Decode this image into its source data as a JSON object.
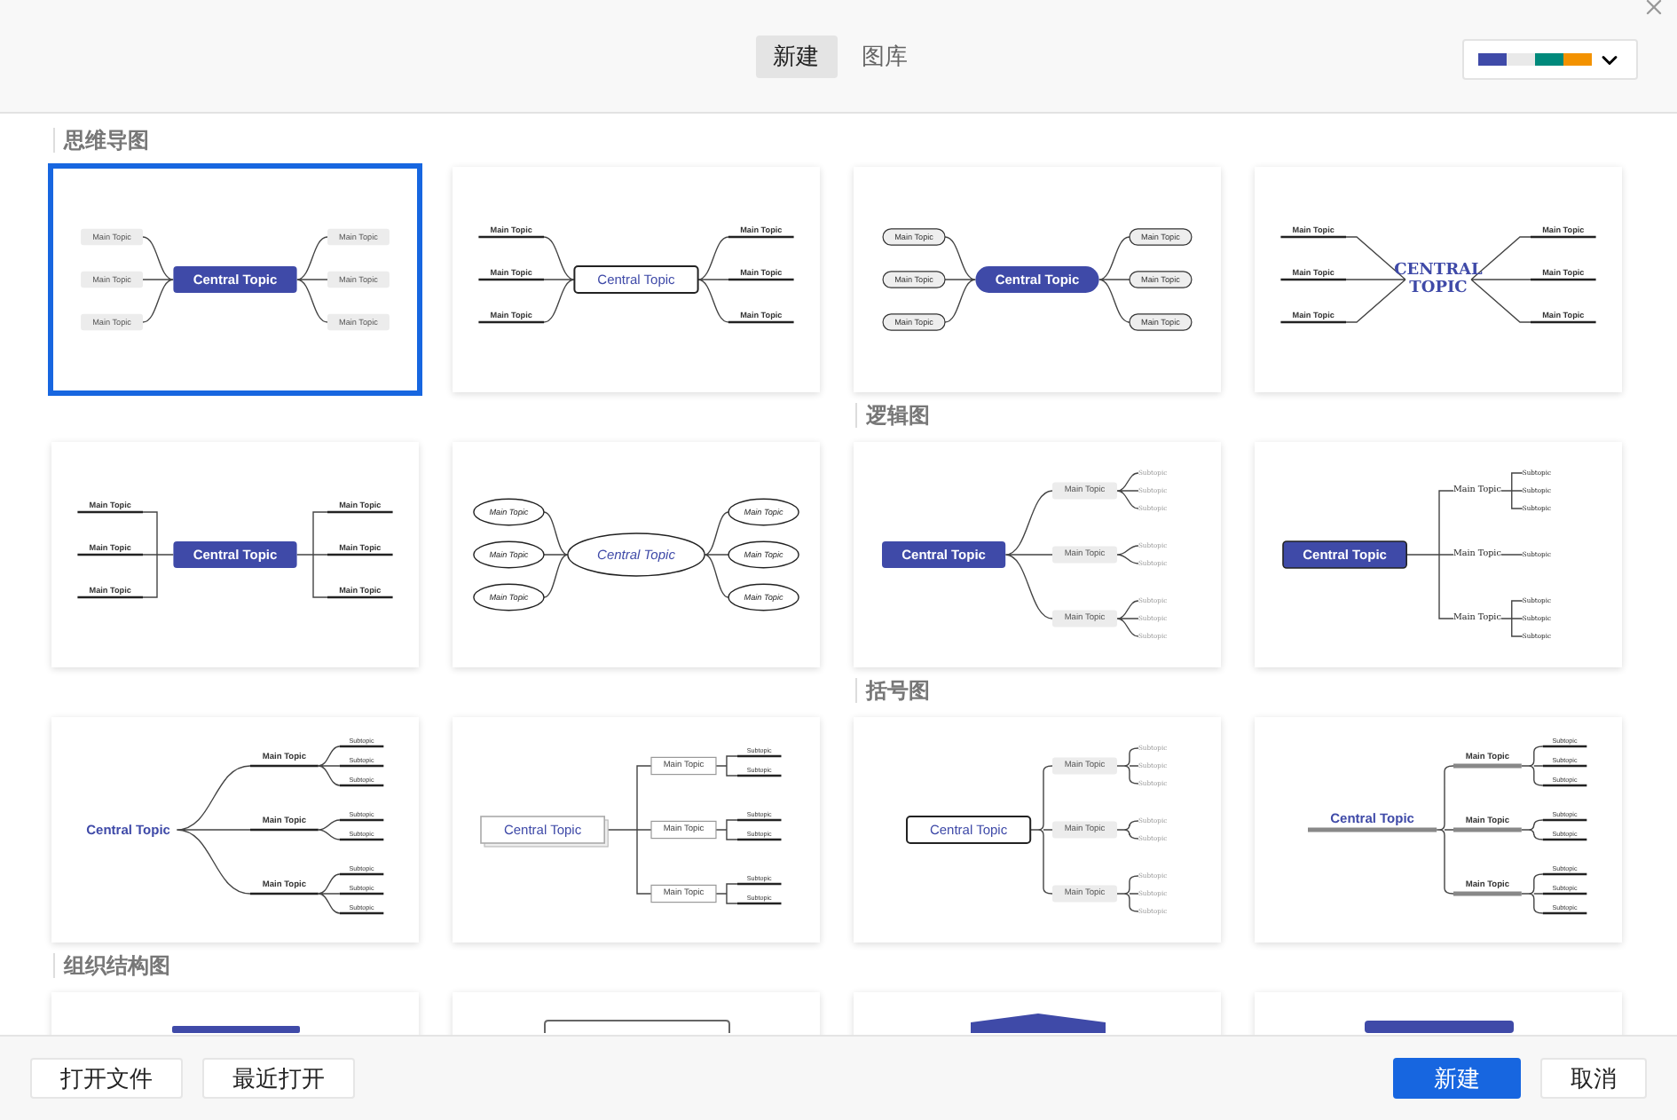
{
  "header": {
    "tabs": [
      {
        "label": "新建",
        "selected": true
      },
      {
        "label": "图库",
        "selected": false
      }
    ],
    "theme_swatches": [
      {
        "color": "#3f4aa8"
      },
      {
        "color": "#e9e9e9"
      },
      {
        "color": "#00897b"
      },
      {
        "color": "#f39200"
      }
    ]
  },
  "sections": [
    {
      "title": "思维导图",
      "templates": [
        {
          "kind": "two-sided",
          "selected": true,
          "links": {
            "kind": "curve"
          },
          "central": {
            "kind": "filled",
            "text": "Central Topic"
          },
          "left": [
            {
              "kind": "box",
              "text": "Main Topic"
            },
            {
              "kind": "box",
              "text": "Main Topic"
            },
            {
              "kind": "box",
              "text": "Main Topic"
            }
          ],
          "right": [
            {
              "kind": "box",
              "text": "Main Topic"
            },
            {
              "kind": "box",
              "text": "Main Topic"
            },
            {
              "kind": "box",
              "text": "Main Topic"
            }
          ]
        },
        {
          "kind": "two-sided",
          "selected": false,
          "links": {
            "kind": "curve"
          },
          "central": {
            "kind": "outline",
            "text": "Central Topic"
          },
          "left": [
            {
              "kind": "underline",
              "text": "Main Topic"
            },
            {
              "kind": "underline",
              "text": "Main Topic"
            },
            {
              "kind": "underline",
              "text": "Main Topic"
            }
          ],
          "right": [
            {
              "kind": "underline",
              "text": "Main Topic"
            },
            {
              "kind": "underline",
              "text": "Main Topic"
            },
            {
              "kind": "underline",
              "text": "Main Topic"
            }
          ]
        },
        {
          "kind": "two-sided",
          "selected": false,
          "links": {
            "kind": "curve"
          },
          "central": {
            "kind": "pill",
            "text": "Central Topic"
          },
          "left": [
            {
              "kind": "outlined",
              "text": "Main Topic"
            },
            {
              "kind": "outlined",
              "text": "Main Topic"
            },
            {
              "kind": "outlined",
              "text": "Main Topic"
            }
          ],
          "right": [
            {
              "kind": "outlined",
              "text": "Main Topic"
            },
            {
              "kind": "outlined",
              "text": "Main Topic"
            },
            {
              "kind": "outlined",
              "text": "Main Topic"
            }
          ]
        },
        {
          "kind": "two-sided",
          "selected": false,
          "links": {
            "kind": "slant"
          },
          "central": {
            "kind": "serif",
            "text": "CENTRAL TOPIC"
          },
          "left": [
            {
              "kind": "underline",
              "text": "Main Topic"
            },
            {
              "kind": "underline",
              "text": "Main Topic"
            },
            {
              "kind": "underline",
              "text": "Main Topic"
            }
          ],
          "right": [
            {
              "kind": "underline",
              "text": "Main Topic"
            },
            {
              "kind": "underline",
              "text": "Main Topic"
            },
            {
              "kind": "underline",
              "text": "Main Topic"
            }
          ]
        },
        {
          "kind": "two-sided",
          "selected": false,
          "links": {
            "kind": "elbow"
          },
          "central": {
            "kind": "filled",
            "text": "Central Topic"
          },
          "left": [
            {
              "kind": "underline",
              "text": "Main Topic"
            },
            {
              "kind": "underline",
              "text": "Main Topic"
            },
            {
              "kind": "underline",
              "text": "Main Topic"
            }
          ],
          "right": [
            {
              "kind": "underline",
              "text": "Main Topic"
            },
            {
              "kind": "underline",
              "text": "Main Topic"
            },
            {
              "kind": "underline",
              "text": "Main Topic"
            }
          ]
        },
        {
          "kind": "two-sided",
          "selected": false,
          "links": {
            "kind": "curve"
          },
          "central": {
            "kind": "ellipse",
            "text": "Central Topic"
          },
          "left": [
            {
              "kind": "ellipse",
              "text": "Main Topic"
            },
            {
              "kind": "ellipse",
              "text": "Main Topic"
            },
            {
              "kind": "ellipse",
              "text": "Main Topic"
            }
          ],
          "right": [
            {
              "kind": "ellipse",
              "text": "Main Topic"
            },
            {
              "kind": "ellipse",
              "text": "Main Topic"
            },
            {
              "kind": "ellipse",
              "text": "Main Topic"
            }
          ]
        }
      ]
    },
    {
      "title": "逻辑图",
      "templates": [
        {
          "kind": "tree",
          "selected": false,
          "links": {
            "kind": "curve"
          },
          "central": {
            "kind": "filled",
            "text": "Central Topic"
          },
          "topics": [
            {
              "kind": "box",
              "text": "Main Topic",
              "links": {
                "kind": "curve"
              },
              "subtopics": [
                {
                  "kind": "faint",
                  "text": "Subtopic"
                },
                {
                  "kind": "faint",
                  "text": "Subtopic"
                },
                {
                  "kind": "faint",
                  "text": "Subtopic"
                }
              ]
            },
            {
              "kind": "box",
              "text": "Main Topic",
              "links": {
                "kind": "curve"
              },
              "subtopics": [
                {
                  "kind": "faint",
                  "text": "Subtopic"
                },
                {
                  "kind": "faint",
                  "text": "Subtopic"
                }
              ]
            },
            {
              "kind": "box",
              "text": "Main Topic",
              "links": {
                "kind": "curve"
              },
              "subtopics": [
                {
                  "kind": "faint",
                  "text": "Subtopic"
                },
                {
                  "kind": "faint",
                  "text": "Subtopic"
                },
                {
                  "kind": "faint",
                  "text": "Subtopic"
                }
              ]
            }
          ]
        },
        {
          "kind": "tree",
          "selected": false,
          "links": {
            "kind": "elbow"
          },
          "central": {
            "kind": "framed",
            "text": "Central Topic"
          },
          "topics": [
            {
              "kind": "serif",
              "text": "Main Topic",
              "links": {
                "kind": "elbow"
              },
              "subtopics": [
                {
                  "kind": "serif",
                  "text": "Subtopic"
                },
                {
                  "kind": "serif",
                  "text": "Subtopic"
                },
                {
                  "kind": "serif",
                  "text": "Subtopic"
                }
              ]
            },
            {
              "kind": "serif",
              "text": "Main Topic",
              "links": {
                "kind": "elbow"
              },
              "subtopics": [
                {
                  "kind": "serif",
                  "text": "Subtopic"
                }
              ]
            },
            {
              "kind": "serif",
              "text": "Main Topic",
              "links": {
                "kind": "elbow"
              },
              "subtopics": [
                {
                  "kind": "serif",
                  "text": "Subtopic"
                },
                {
                  "kind": "serif",
                  "text": "Subtopic"
                },
                {
                  "kind": "serif",
                  "text": "Subtopic"
                }
              ]
            }
          ]
        },
        {
          "kind": "tree",
          "selected": false,
          "links": {
            "kind": "curve"
          },
          "central": {
            "kind": "text",
            "text": "Central Topic"
          },
          "topics": [
            {
              "kind": "underline",
              "text": "Main Topic",
              "links": {
                "kind": "curve"
              },
              "subtopics": [
                {
                  "kind": "underline",
                  "text": "Subtopic"
                },
                {
                  "kind": "underline",
                  "text": "Subtopic"
                },
                {
                  "kind": "underline",
                  "text": "Subtopic"
                }
              ]
            },
            {
              "kind": "underline",
              "text": "Main Topic",
              "links": {
                "kind": "curve"
              },
              "subtopics": [
                {
                  "kind": "underline",
                  "text": "Subtopic"
                },
                {
                  "kind": "underline",
                  "text": "Subtopic"
                }
              ]
            },
            {
              "kind": "underline",
              "text": "Main Topic",
              "links": {
                "kind": "curve"
              },
              "subtopics": [
                {
                  "kind": "underline",
                  "text": "Subtopic"
                },
                {
                  "kind": "underline",
                  "text": "Subtopic"
                },
                {
                  "kind": "underline",
                  "text": "Subtopic"
                }
              ]
            }
          ]
        },
        {
          "kind": "tree",
          "selected": false,
          "links": {
            "kind": "elbow"
          },
          "central": {
            "kind": "stacked",
            "text": "Central Topic"
          },
          "topics": [
            {
              "kind": "card",
              "text": "Main Topic",
              "links": {
                "kind": "elbow"
              },
              "subtopics": [
                {
                  "kind": "underline",
                  "text": "Subtopic"
                },
                {
                  "kind": "underline",
                  "text": "Subtopic"
                }
              ]
            },
            {
              "kind": "card",
              "text": "Main Topic",
              "links": {
                "kind": "elbow"
              },
              "subtopics": [
                {
                  "kind": "underline",
                  "text": "Subtopic"
                },
                {
                  "kind": "underline",
                  "text": "Subtopic"
                }
              ]
            },
            {
              "kind": "card",
              "text": "Main Topic",
              "links": {
                "kind": "elbow"
              },
              "subtopics": [
                {
                  "kind": "underline",
                  "text": "Subtopic"
                },
                {
                  "kind": "underline",
                  "text": "Subtopic"
                }
              ]
            }
          ]
        }
      ]
    },
    {
      "title": "括号图",
      "templates": [
        {
          "kind": "tree",
          "selected": false,
          "links": {
            "kind": "brace"
          },
          "central": {
            "kind": "outline",
            "text": "Central Topic"
          },
          "topics": [
            {
              "kind": "box",
              "text": "Main Topic",
              "links": {
                "kind": "brace"
              },
              "subtopics": [
                {
                  "kind": "faint",
                  "text": "Subtopic"
                },
                {
                  "kind": "faint",
                  "text": "Subtopic"
                },
                {
                  "kind": "faint",
                  "text": "Subtopic"
                }
              ]
            },
            {
              "kind": "box",
              "text": "Main Topic",
              "links": {
                "kind": "brace"
              },
              "subtopics": [
                {
                  "kind": "faint",
                  "text": "Subtopic"
                },
                {
                  "kind": "faint",
                  "text": "Subtopic"
                }
              ]
            },
            {
              "kind": "box",
              "text": "Main Topic",
              "links": {
                "kind": "brace"
              },
              "subtopics": [
                {
                  "kind": "faint",
                  "text": "Subtopic"
                },
                {
                  "kind": "faint",
                  "text": "Subtopic"
                },
                {
                  "kind": "faint",
                  "text": "Subtopic"
                }
              ]
            }
          ]
        },
        {
          "kind": "tree",
          "selected": false,
          "links": {
            "kind": "brace"
          },
          "central": {
            "kind": "bar",
            "text": "Central Topic"
          },
          "topics": [
            {
              "kind": "bar",
              "text": "Main Topic",
              "links": {
                "kind": "brace"
              },
              "subtopics": [
                {
                  "kind": "underline",
                  "text": "Subtopic"
                },
                {
                  "kind": "underline",
                  "text": "Subtopic"
                },
                {
                  "kind": "underline",
                  "text": "Subtopic"
                }
              ]
            },
            {
              "kind": "bar",
              "text": "Main Topic",
              "links": {
                "kind": "brace"
              },
              "subtopics": [
                {
                  "kind": "underline",
                  "text": "Subtopic"
                },
                {
                  "kind": "underline",
                  "text": "Subtopic"
                }
              ]
            },
            {
              "kind": "bar",
              "text": "Main Topic",
              "links": {
                "kind": "brace"
              },
              "subtopics": [
                {
                  "kind": "underline",
                  "text": "Subtopic"
                },
                {
                  "kind": "underline",
                  "text": "Subtopic"
                },
                {
                  "kind": "underline",
                  "text": "Subtopic"
                }
              ]
            }
          ]
        }
      ]
    },
    {
      "title": "组织结构图",
      "templates": [
        {
          "kind": "org",
          "selected": false,
          "central": {
            "kind": "text"
          }
        },
        {
          "kind": "org",
          "selected": false,
          "central": {
            "kind": "outline"
          }
        },
        {
          "kind": "org",
          "selected": false,
          "central": {
            "kind": "hexagon"
          }
        },
        {
          "kind": "org",
          "selected": false,
          "central": {
            "kind": "filled"
          }
        }
      ]
    }
  ],
  "footer": {
    "left_buttons": [
      "打开文件",
      "最近打开"
    ],
    "primary_button": "新建",
    "secondary_button": "取消"
  }
}
